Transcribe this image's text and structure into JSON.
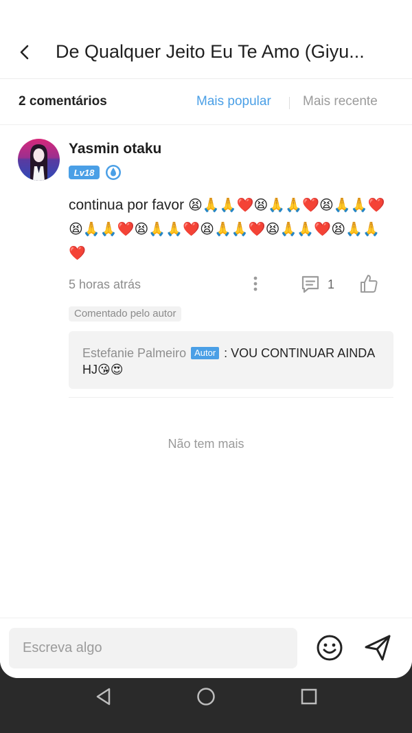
{
  "header": {
    "title": "De Qualquer Jeito Eu Te Amo (Giyu..."
  },
  "sort": {
    "count_label": "2 comentários",
    "popular_label": "Mais popular",
    "recent_label": "Mais recente"
  },
  "comment": {
    "username": "Yasmin otaku",
    "level": "Lv18",
    "text_prefix": "continua por favor ",
    "emoji_line": "😫🙏🙏❤️😫🙏🙏❤️😫🙏🙏❤️😫🙏🙏❤️😫🙏🙏❤️😫🙏🙏❤️😫🙏🙏❤️😫🙏🙏❤️",
    "time": "5 horas atrás",
    "reply_count": "1",
    "author_tag": "Comentado pelo autor",
    "reply": {
      "author": "Estefanie Palmeiro",
      "badge": "Autor",
      "text": " : VOU CONTINUAR AINDA HJ😘😍"
    }
  },
  "footer": {
    "no_more": "Não tem mais",
    "input_placeholder": "Escreva algo"
  },
  "colors": {
    "accent": "#4a9fe6",
    "muted": "#9b9b9b"
  }
}
